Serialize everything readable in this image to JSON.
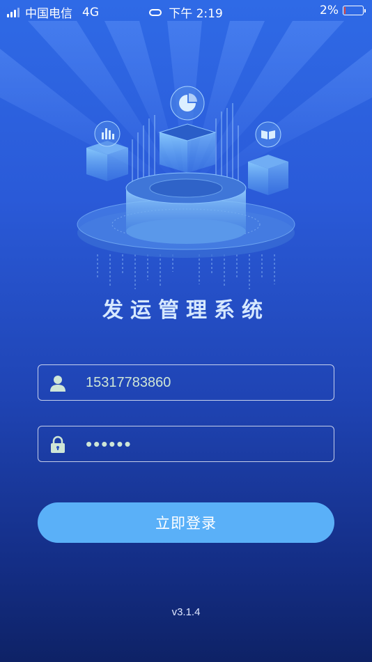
{
  "status_bar": {
    "carrier": "中国电信",
    "network": "4G",
    "time": "下午 2:19",
    "battery": "2%"
  },
  "app_title": "发运管理系统",
  "login_form": {
    "username_value": "15317783860",
    "password_value": "••••••",
    "login_button_label": "立即登录"
  },
  "version": "v3.1.4",
  "icons": {
    "user": "user-icon",
    "lock": "lock-icon",
    "signal": "signal-icon",
    "link": "link-icon",
    "battery": "battery-icon"
  },
  "colors": {
    "button": "#5ab0f8",
    "input_text": "#cfe6d6",
    "title": "#d6e8ff"
  }
}
